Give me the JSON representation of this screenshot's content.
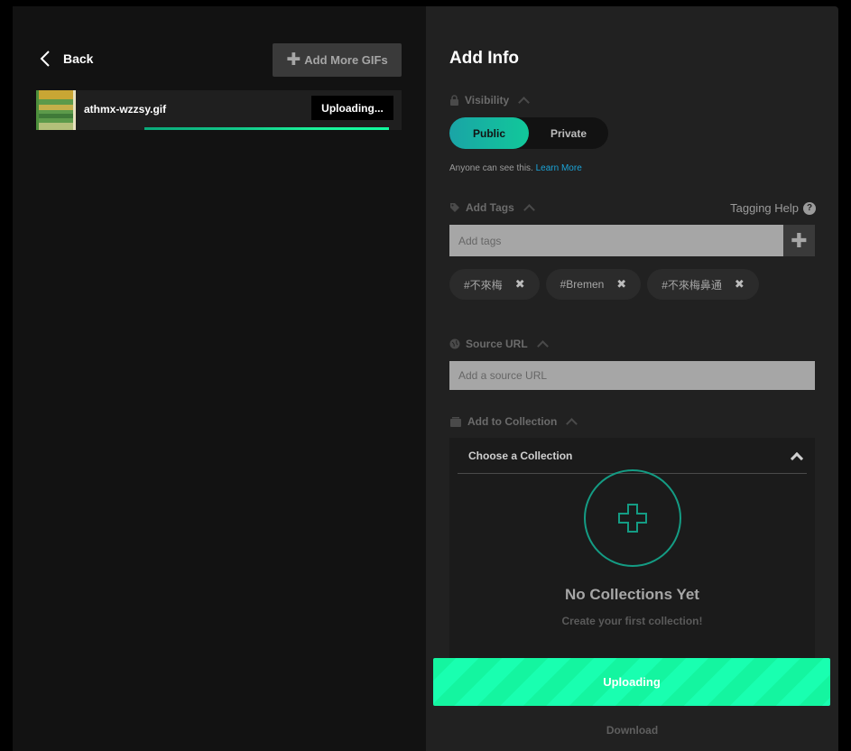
{
  "left": {
    "back_label": "Back",
    "add_more_label": "Add More GIFs",
    "file": {
      "name": "athmx-wzzsy.gif",
      "status": "Uploading...",
      "progress": 0.95
    }
  },
  "right": {
    "title": "Add Info",
    "visibility": {
      "label": "Visibility",
      "options": [
        "Public",
        "Private"
      ],
      "selected": "Public",
      "note": "Anyone can see this.",
      "learn_more": "Learn More"
    },
    "tags": {
      "label": "Add Tags",
      "help_label": "Tagging Help",
      "placeholder": "Add tags",
      "items": [
        "#不來梅",
        "#Bremen",
        "#不來梅鼻通"
      ]
    },
    "source": {
      "label": "Source URL",
      "placeholder": "Add a source URL"
    },
    "collection": {
      "label": "Add to Collection",
      "choose_label": "Choose a Collection",
      "empty_title": "No Collections Yet",
      "empty_subtitle": "Create your first collection!"
    },
    "upload_button": "Uploading",
    "download_label": "Download"
  },
  "colors": {
    "accent_green": "#14f5a0",
    "accent_teal": "#1aa4a6",
    "link_blue": "#1ba4d8"
  }
}
